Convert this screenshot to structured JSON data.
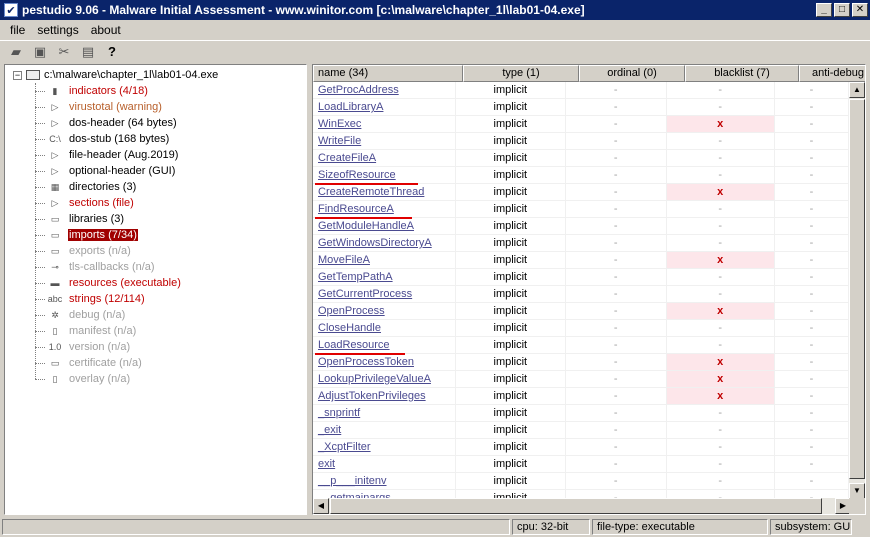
{
  "window": {
    "title": "pestudio 9.06 - Malware Initial Assessment - www.winitor.com [c:\\malware\\chapter_1l\\lab01-04.exe]",
    "buttons": {
      "minimize": "_",
      "maximize": "□",
      "close": "✕"
    }
  },
  "menu": [
    "file",
    "settings",
    "about"
  ],
  "toolbar": {
    "icons": [
      "open-icon",
      "save-icon",
      "close-file-icon",
      "copy-icon",
      "help-icon"
    ]
  },
  "tree": {
    "root": "c:\\malware\\chapter_1l\\lab01-04.exe",
    "items": [
      {
        "label": "indicators (4/18)",
        "color": "red",
        "icon": "indicators-icon",
        "glyph": "▮"
      },
      {
        "label": "virustotal (warning)",
        "color": "orange",
        "icon": "virustotal-icon",
        "glyph": "▷"
      },
      {
        "label": "dos-header (64 bytes)",
        "color": "black",
        "icon": "arrow-icon",
        "glyph": "▷"
      },
      {
        "label": "dos-stub (168 bytes)",
        "color": "black",
        "icon": "dos-stub-icon",
        "glyph": "C:\\"
      },
      {
        "label": "file-header (Aug.2019)",
        "color": "black",
        "icon": "arrow-icon",
        "glyph": "▷"
      },
      {
        "label": "optional-header (GUI)",
        "color": "black",
        "icon": "arrow-icon",
        "glyph": "▷"
      },
      {
        "label": "directories (3)",
        "color": "black",
        "icon": "directories-icon",
        "glyph": "▦"
      },
      {
        "label": "sections (file)",
        "color": "red",
        "icon": "arrow-icon",
        "glyph": "▷"
      },
      {
        "label": "libraries (3)",
        "color": "black",
        "icon": "libraries-icon",
        "glyph": "▭"
      },
      {
        "label": "imports (7/34)",
        "color": "red",
        "icon": "imports-icon",
        "glyph": "▭",
        "selected": true
      },
      {
        "label": "exports (n/a)",
        "color": "gray",
        "icon": "exports-icon",
        "glyph": "▭"
      },
      {
        "label": "tls-callbacks (n/a)",
        "color": "gray",
        "icon": "tls-callbacks-icon",
        "glyph": "⊸"
      },
      {
        "label": "resources (executable)",
        "color": "red",
        "icon": "resources-icon",
        "glyph": "▬"
      },
      {
        "label": "strings (12/114)",
        "color": "red",
        "icon": "strings-icon",
        "glyph": "abc"
      },
      {
        "label": "debug (n/a)",
        "color": "gray",
        "icon": "debug-icon",
        "glyph": "✲"
      },
      {
        "label": "manifest (n/a)",
        "color": "gray",
        "icon": "manifest-icon",
        "glyph": "▯"
      },
      {
        "label": "version (n/a)",
        "color": "gray",
        "icon": "version-icon",
        "glyph": "1.0"
      },
      {
        "label": "certificate (n/a)",
        "color": "gray",
        "icon": "certificate-icon",
        "glyph": "▭"
      },
      {
        "label": "overlay (n/a)",
        "color": "gray",
        "icon": "overlay-icon",
        "glyph": "▯"
      }
    ]
  },
  "table": {
    "columns": [
      "name (34)",
      "type (1)",
      "ordinal (0)",
      "blacklist (7)",
      "anti-debug"
    ],
    "dash": "-",
    "mark": "x",
    "rows": [
      {
        "name": "GetProcAddress",
        "type": "implicit",
        "blacklist": false
      },
      {
        "name": "LoadLibraryA",
        "type": "implicit",
        "blacklist": false
      },
      {
        "name": "WinExec",
        "type": "implicit",
        "blacklist": true
      },
      {
        "name": "WriteFile",
        "type": "implicit",
        "blacklist": false
      },
      {
        "name": "CreateFileA",
        "type": "implicit",
        "blacklist": false
      },
      {
        "name": "SizeofResource",
        "type": "implicit",
        "blacklist": false,
        "underlined": true
      },
      {
        "name": "CreateRemoteThread",
        "type": "implicit",
        "blacklist": true
      },
      {
        "name": "FindResourceA",
        "type": "implicit",
        "blacklist": false,
        "underlined": true
      },
      {
        "name": "GetModuleHandleA",
        "type": "implicit",
        "blacklist": false
      },
      {
        "name": "GetWindowsDirectoryA",
        "type": "implicit",
        "blacklist": false
      },
      {
        "name": "MoveFileA",
        "type": "implicit",
        "blacklist": true
      },
      {
        "name": "GetTempPathA",
        "type": "implicit",
        "blacklist": false
      },
      {
        "name": "GetCurrentProcess",
        "type": "implicit",
        "blacklist": false
      },
      {
        "name": "OpenProcess",
        "type": "implicit",
        "blacklist": true
      },
      {
        "name": "CloseHandle",
        "type": "implicit",
        "blacklist": false
      },
      {
        "name": "LoadResource",
        "type": "implicit",
        "blacklist": false,
        "underlined": true
      },
      {
        "name": "OpenProcessToken",
        "type": "implicit",
        "blacklist": true
      },
      {
        "name": "LookupPrivilegeValueA",
        "type": "implicit",
        "blacklist": true
      },
      {
        "name": "AdjustTokenPrivileges",
        "type": "implicit",
        "blacklist": true
      },
      {
        "name": "_snprintf",
        "type": "implicit",
        "blacklist": false
      },
      {
        "name": "_exit",
        "type": "implicit",
        "blacklist": false
      },
      {
        "name": "_XcptFilter",
        "type": "implicit",
        "blacklist": false
      },
      {
        "name": "exit",
        "type": "implicit",
        "blacklist": false
      },
      {
        "name": "__p___initenv",
        "type": "implicit",
        "blacklist": false
      },
      {
        "name": "__getmainargs",
        "type": "implicit",
        "blacklist": false
      }
    ]
  },
  "status": {
    "cpu": "cpu: 32-bit",
    "filetype": "file-type: executable",
    "subsystem": "subsystem: GUI"
  },
  "colors": {
    "title_bg": "#0a246a",
    "highlight_red": "#c00000",
    "selected_bg": "#a00000",
    "blacklist_bg": "#fde6ea",
    "link": "#4a4a90"
  }
}
